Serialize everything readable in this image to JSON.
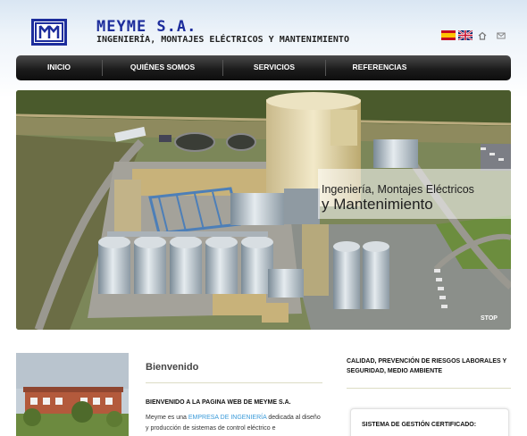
{
  "header": {
    "brand_title": "MEYME S.A.",
    "brand_subtitle": "INGENIERÍA, MONTAJES ELÉCTRICOS Y MANTENIMIENTO",
    "logo_icon": "meyme-logo",
    "languages": [
      "es-flag-icon",
      "uk-flag-icon"
    ],
    "utility_icons": [
      "home-icon",
      "mail-icon"
    ]
  },
  "nav": {
    "items": [
      {
        "label": "INICIO"
      },
      {
        "label": "QUIÉNES SOMOS"
      },
      {
        "label": "SERVICIOS"
      },
      {
        "label": "REFERENCIAS"
      }
    ]
  },
  "hero": {
    "line1": "Ingeniería, Montajes Eléctricos",
    "line2": "y Mantenimiento",
    "stop_label": "STOP"
  },
  "welcome": {
    "title": "Bienvenido",
    "heading": "BIENVENIDO A LA PAGINA WEB DE MEYME S.A.",
    "text_before_link": "Meyme es una ",
    "link_text": "EMPRESA DE INGENIERÍA",
    "text_after_link": " dedicada al diseño y producción de sistemas de control eléctrico e"
  },
  "right": {
    "heading": "CALIDAD, PREVENCIÓN DE RIESGOS LABORALES Y SEGURIDAD, MEDIO AMBIENTE",
    "cert_title": "SISTEMA DE GESTIÓN CERTIFICADO:"
  },
  "colors": {
    "brand_blue": "#1d2d9c",
    "nav_dark": "#1c1c1c",
    "link_blue": "#3a9ad9"
  }
}
